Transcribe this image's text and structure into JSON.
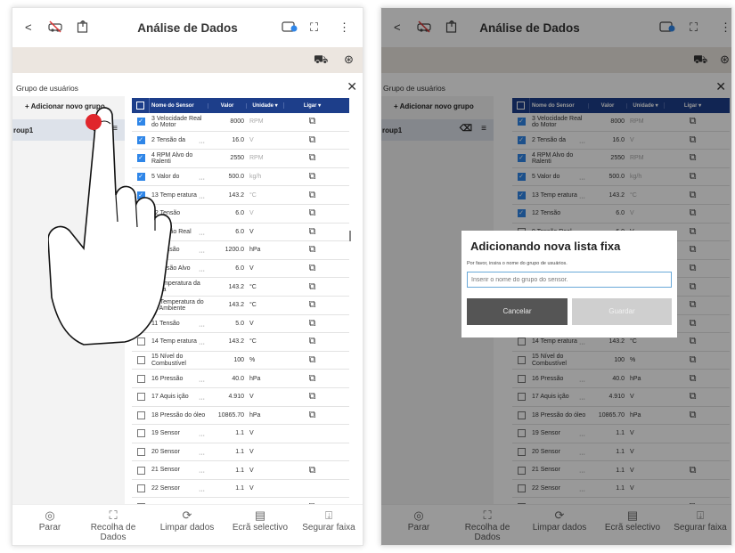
{
  "app": {
    "title": "Análise de Dados",
    "back_glyph": "<",
    "more_glyph": "⋮"
  },
  "group": {
    "header": "Grupo de usuários",
    "add_button": "+ Adicionar novo grupo",
    "items": [
      {
        "name": "roup1"
      }
    ]
  },
  "table": {
    "columns": [
      "Nome do Sensor",
      "Valor",
      "Unidade",
      "Ligar"
    ],
    "rows": [
      {
        "name": "3 Velocidade Real do Motor",
        "value": "8000",
        "unit": "RPM",
        "checked": true,
        "dots": false,
        "toggle": true
      },
      {
        "name": "2 Tensão da",
        "value": "16.0",
        "unit": "V",
        "checked": true,
        "dots": true,
        "toggle": true
      },
      {
        "name": "4 RPM Alvo do Ralenti",
        "value": "2550",
        "unit": "RPM",
        "checked": true,
        "dots": false,
        "toggle": true
      },
      {
        "name": "5 Valor do",
        "value": "500.0",
        "unit": "kg/h",
        "checked": true,
        "dots": true,
        "toggle": true
      },
      {
        "name": "13 Temp eratura",
        "value": "143.2",
        "unit": "°C",
        "checked": true,
        "dots": true,
        "toggle": true
      },
      {
        "name": "12 Tensão",
        "value": "6.0",
        "unit": "V",
        "checked": true,
        "dots": false,
        "toggle": true
      },
      {
        "name": "9 Tensão Real",
        "value": "6.0",
        "unit": "V",
        "checked": false,
        "dots": true,
        "toggle": true
      },
      {
        "name": "6 Pressão",
        "value": "1200.0",
        "unit": "hPa",
        "checked": false,
        "dots": true,
        "toggle": true
      },
      {
        "name": "7 Tensão Alvo",
        "value": "6.0",
        "unit": "V",
        "checked": false,
        "dots": true,
        "toggle": true
      },
      {
        "name": "8 Temperatura da Água",
        "value": "143.2",
        "unit": "°C",
        "checked": false,
        "dots": false,
        "toggle": true
      },
      {
        "name": "10 Temperatura do Ar Ambiente",
        "value": "143.2",
        "unit": "°C",
        "checked": false,
        "dots": false,
        "toggle": true
      },
      {
        "name": "11 Tensão",
        "value": "5.0",
        "unit": "V",
        "checked": false,
        "dots": true,
        "toggle": true
      },
      {
        "name": "14 Temp eratura",
        "value": "143.2",
        "unit": "°C",
        "checked": false,
        "dots": true,
        "toggle": true
      },
      {
        "name": "15 Nível do Combustível",
        "value": "100",
        "unit": "%",
        "checked": false,
        "dots": false,
        "toggle": true
      },
      {
        "name": "16 Pressão",
        "value": "40.0",
        "unit": "hPa",
        "checked": false,
        "dots": true,
        "toggle": true
      },
      {
        "name": "17 Aquis ição",
        "value": "4.910",
        "unit": "V",
        "checked": false,
        "dots": true,
        "toggle": true
      },
      {
        "name": "18 Pressão do óleo",
        "value": "10865.70",
        "unit": "hPa",
        "checked": false,
        "dots": false,
        "toggle": true
      },
      {
        "name": "19 Sensor",
        "value": "1.1",
        "unit": "V",
        "checked": false,
        "dots": true,
        "toggle": false
      },
      {
        "name": "20 Sensor",
        "value": "1.1",
        "unit": "V",
        "checked": false,
        "dots": true,
        "toggle": false
      },
      {
        "name": "21 Sensor",
        "value": "1.1",
        "unit": "V",
        "checked": false,
        "dots": true,
        "toggle": true
      },
      {
        "name": "22 Sensor",
        "value": "1.1",
        "unit": "V",
        "checked": false,
        "dots": true,
        "toggle": false
      },
      {
        "name": "23 Sensor",
        "value": "5.0",
        "unit": "V",
        "checked": false,
        "dots": true,
        "toggle": true
      }
    ]
  },
  "bottom_nav": [
    {
      "label": "Parar",
      "icon": "stop-icon",
      "glyph": "◎"
    },
    {
      "label": "Recolha de Dados",
      "icon": "capture-icon",
      "glyph": "⛶"
    },
    {
      "label": "Limpar dados",
      "icon": "refresh-icon",
      "glyph": "⟳"
    },
    {
      "label": "Ecrã selectivo",
      "icon": "selective-screen-icon",
      "glyph": "▤"
    },
    {
      "label": "Segurar faixa",
      "icon": "hold-icon",
      "glyph": "⍗"
    }
  ],
  "dialog": {
    "title": "Adicionando nova lista fixa",
    "subtitle": "Por favor, insira o nome do grupo de usuários.",
    "placeholder": "Inserir o nome do grupo do sensor.",
    "cancel": "Cancelar",
    "save": "Guardar"
  },
  "colors": {
    "accent": "#1d3e8a",
    "checkbox": "#2f86e8",
    "touch_marker": "#e0262c"
  }
}
